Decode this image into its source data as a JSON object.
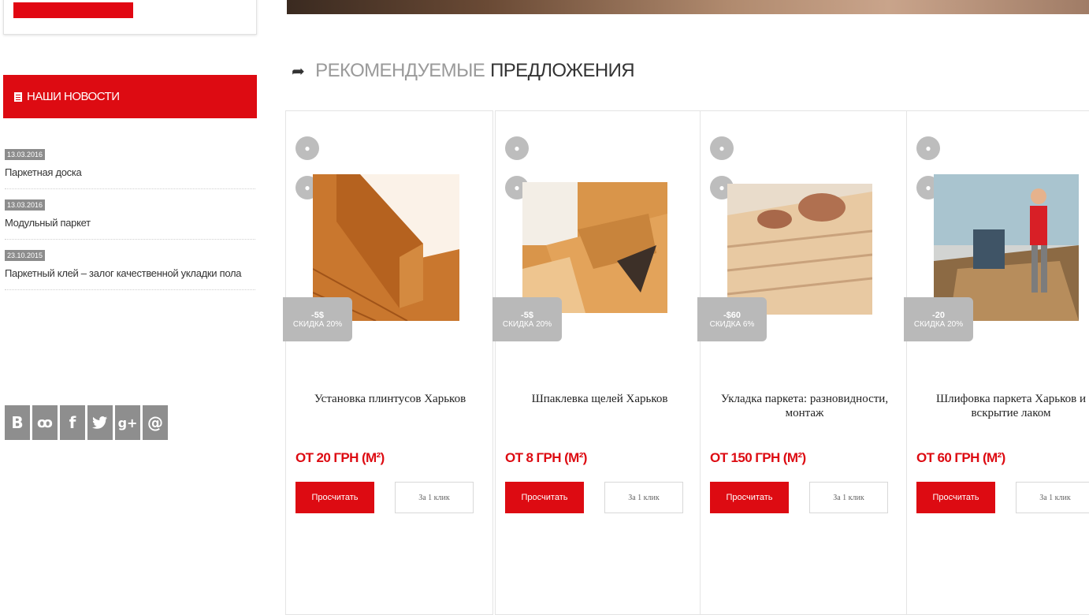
{
  "sidebar": {
    "news_header": "НАШИ НОВОСТИ",
    "news": [
      {
        "date": "13.03.2016",
        "title": "Паркетная доска"
      },
      {
        "date": "13.03.2016",
        "title": "Модульный паркет"
      },
      {
        "date": "23.10.2015",
        "title": "Паркетный клей – залог качественной укладки пола"
      }
    ],
    "social": [
      "В",
      "ok",
      "f",
      "t",
      "g+",
      "@"
    ]
  },
  "main": {
    "section_title_light": "РЕКОМЕНДУЕМЫЕ",
    "section_title_dark": "ПРЕДЛОЖЕНИЯ",
    "products": [
      {
        "badge_value": "-5$",
        "badge_text": "СКИДКА 20%",
        "title": "Установка плинтусов Харьков",
        "price": "ОТ 20 ГРН (М²)",
        "calc": "Просчитать",
        "one_click": "За 1 клик"
      },
      {
        "badge_value": "-5$",
        "badge_text": "СКИДКА 20%",
        "title": "Шпаклевка щелей Харьков",
        "price": "ОТ 8 ГРН (М²)",
        "calc": "Просчитать",
        "one_click": "За 1 клик"
      },
      {
        "badge_value": "-$60",
        "badge_text": "СКИДКА 6%",
        "title": "Укладка паркета: разновидности, монтаж",
        "price": "ОТ 150 ГРН (М²)",
        "calc": "Просчитать",
        "one_click": "За 1 клик"
      },
      {
        "badge_value": "-20",
        "badge_text": "СКИДКА 20%",
        "title": "Шлифовка паркета Харьков и вскрытие лаком",
        "price": "ОТ 60 ГРН (М²)",
        "calc": "Просчитать",
        "one_click": "За 1 клик"
      }
    ]
  },
  "colors": {
    "accent": "#dd0b12",
    "badge_gray": "#b9b9b9"
  }
}
